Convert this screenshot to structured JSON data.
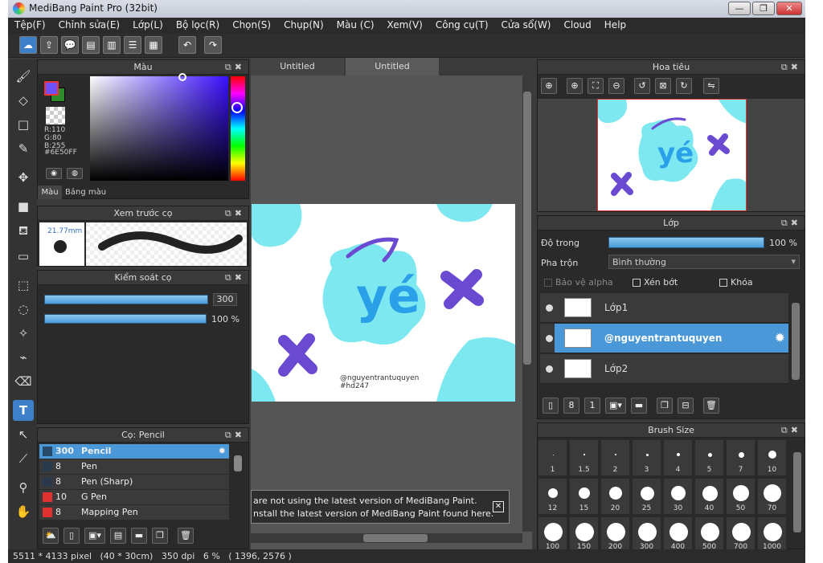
{
  "window": {
    "title": "MediBang Paint Pro (32bit)"
  },
  "menu": [
    "Tệp(F)",
    "Chỉnh sửa(E)",
    "Lớp(L)",
    "Bộ lọc(R)",
    "Chọn(S)",
    "Chụp(N)",
    "Màu (C)",
    "Xem(V)",
    "Công cụ(T)",
    "Cửa sổ(W)",
    "Cloud",
    "Help"
  ],
  "color_panel": {
    "title": "Màu",
    "r": "R:110",
    "g": "G:80",
    "b": "B:255",
    "hex": "#6E50FF",
    "tabs": [
      "Màu",
      "Bảng màu"
    ],
    "fg_color": "#6E50FF",
    "bg_color": "#2e8b2e"
  },
  "brush_preview": {
    "title": "Xem trước cọ",
    "size": "21.77mm"
  },
  "brush_control": {
    "title": "Kiểm soát cọ",
    "size_value": "300",
    "opacity_value": "100 %",
    "size_fraction": 1.0,
    "opacity_fraction": 1.0
  },
  "brush_list": {
    "title": "Cọ: Pencil",
    "items": [
      {
        "size": "300",
        "name": "Pencil",
        "color": "#2a4a6a",
        "selected": true
      },
      {
        "size": "8",
        "name": "Pen",
        "color": "#2a3a4a",
        "selected": false
      },
      {
        "size": "8",
        "name": "Pen (Sharp)",
        "color": "#2a3a4a",
        "selected": false
      },
      {
        "size": "10",
        "name": "G Pen",
        "color": "#e03030",
        "selected": false
      },
      {
        "size": "8",
        "name": "Mapping Pen",
        "color": "#e03030",
        "selected": false
      }
    ]
  },
  "doc_tabs": [
    "Untitled",
    "Untitled"
  ],
  "canvas": {
    "signature": "@nguyentrantuquyen",
    "tag": "#hd247"
  },
  "notification": {
    "line1": "are not using the latest version of MediBang Paint.",
    "line2": "nstall the latest version of MediBang Paint found here."
  },
  "navigator": {
    "title": "Hoa tiêu"
  },
  "layers": {
    "title": "Lớp",
    "opacity_label": "Độ trong",
    "opacity_value": "100 %",
    "opacity_fraction": 1.0,
    "blend_label": "Pha trộn",
    "blend_value": "Bình thường",
    "protect_alpha": "Bảo vệ alpha",
    "clipping": "Xén bớt",
    "lock": "Khóa",
    "items": [
      {
        "name": "Lớp1",
        "selected": false
      },
      {
        "name": "@nguyentrantuquyen",
        "selected": true
      },
      {
        "name": "Lớp2",
        "selected": false
      }
    ]
  },
  "brush_size": {
    "title": "Brush Size",
    "sizes": [
      "1",
      "1.5",
      "2",
      "3",
      "4",
      "5",
      "7",
      "10",
      "12",
      "15",
      "20",
      "25",
      "30",
      "40",
      "50",
      "70",
      "100",
      "150",
      "200",
      "300",
      "400",
      "500",
      "700",
      "1000"
    ]
  },
  "status": {
    "text": "5511 * 4133 pixel   (40 * 30cm)   350 dpi   6 %   ( 1396, 2576 )"
  }
}
